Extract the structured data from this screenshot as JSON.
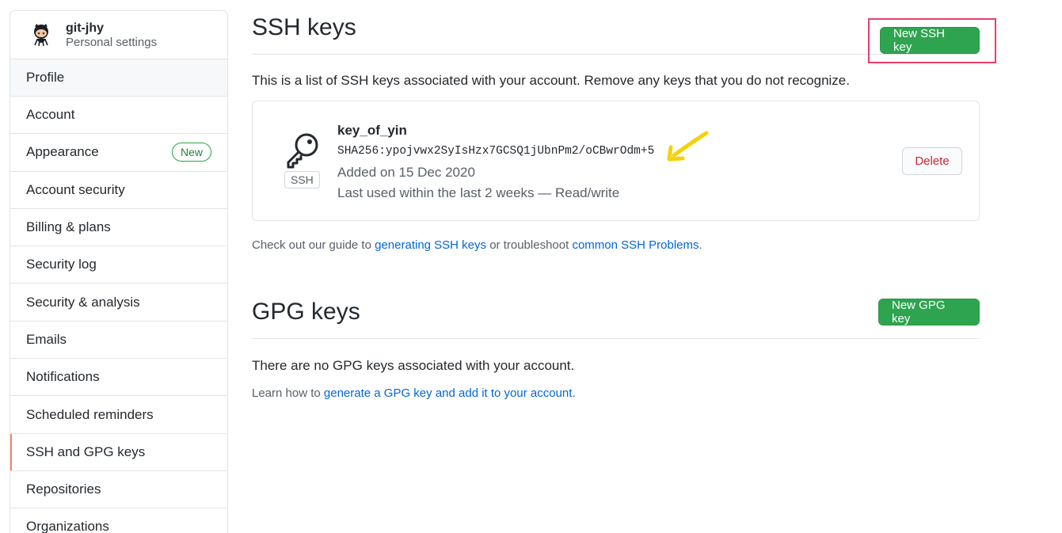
{
  "sidebar": {
    "username": "git-jhy",
    "subtitle": "Personal settings",
    "items": [
      {
        "label": "Profile"
      },
      {
        "label": "Account"
      },
      {
        "label": "Appearance",
        "badge": "New"
      },
      {
        "label": "Account security"
      },
      {
        "label": "Billing & plans"
      },
      {
        "label": "Security log"
      },
      {
        "label": "Security & analysis"
      },
      {
        "label": "Emails"
      },
      {
        "label": "Notifications"
      },
      {
        "label": "Scheduled reminders"
      },
      {
        "label": "SSH and GPG keys",
        "selected": true
      },
      {
        "label": "Repositories"
      },
      {
        "label": "Organizations"
      }
    ]
  },
  "ssh": {
    "title": "SSH keys",
    "new_button": "New SSH key",
    "intro": "This is a list of SSH keys associated with your account. Remove any keys that you do not recognize.",
    "key": {
      "type_label": "SSH",
      "name": "key_of_yin",
      "fingerprint": "SHA256:ypojvwx2SyIsHzx7GCSQ1jUbnPm2/oCBwrOdm+5",
      "added": "Added on 15 Dec 2020",
      "last_used": "Last used within the last 2 weeks — Read/write",
      "delete_button": "Delete"
    },
    "guide": {
      "prefix": "Check out our guide to ",
      "link1": "generating SSH keys",
      "middle": " or troubleshoot ",
      "link2": "common SSH Problems",
      "suffix": "."
    }
  },
  "gpg": {
    "title": "GPG keys",
    "new_button": "New GPG key",
    "empty": "There are no GPG keys associated with your account.",
    "learn_prefix": "Learn how to ",
    "learn_link": "generate a GPG key and add it to your account",
    "learn_suffix": "."
  },
  "colors": {
    "primary_green": "#2ea44f",
    "link_blue": "#0366d6",
    "danger_red": "#cb2431",
    "highlight_box": "#e83e6c",
    "annotation_arrow": "#f5d20a"
  }
}
